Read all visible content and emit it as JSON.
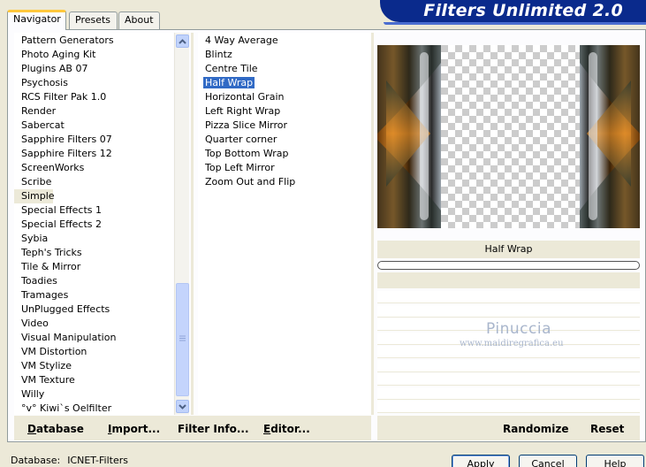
{
  "tabs": [
    "Navigator",
    "Presets",
    "About"
  ],
  "banner": {
    "title": "Filters Unlimited 2.0"
  },
  "categories": [
    "Pattern Generators",
    "Photo Aging Kit",
    "Plugins AB 07",
    "Psychosis",
    "RCS Filter Pak 1.0",
    "Render",
    "Sabercat",
    "Sapphire Filters 07",
    "Sapphire Filters 12",
    "ScreenWorks",
    "Scribe",
    "Simple",
    "Special Effects 1",
    "Special Effects 2",
    "Sybia",
    "Teph's Tricks",
    "Tile & Mirror",
    "Toadies",
    "Tramages",
    "UnPlugged Effects",
    "Video",
    "Visual Manipulation",
    "VM Distortion",
    "VM Stylize",
    "VM Texture",
    "Willy",
    "°v° Kiwi`s Oelfilter"
  ],
  "selected_category": "Simple",
  "filters": [
    "4 Way Average",
    "Blintz",
    "Centre Tile",
    "Half Wrap",
    "Horizontal Grain",
    "Left Right Wrap",
    "Pizza Slice Mirror",
    "Quarter corner",
    "Top Bottom Wrap",
    "Top Left Mirror",
    "Zoom Out and Flip"
  ],
  "selected_filter": "Half Wrap",
  "preview": {
    "filter_name": "Half Wrap"
  },
  "watermark": {
    "title": "Pinuccia",
    "url": "www.maidiregrafica.eu"
  },
  "toolbar": {
    "database": "Database",
    "import": "Import...",
    "filter_info": "Filter Info...",
    "editor": "Editor...",
    "randomize": "Randomize",
    "reset": "Reset"
  },
  "status": {
    "label": "Database:",
    "value": "ICNET-Filters"
  },
  "dialog": {
    "apply": "Apply",
    "cancel": "Cancel",
    "help": "Help"
  },
  "colors": {
    "banner": "#0a2a8c",
    "selection": "#316ac5",
    "face": "#ece9d8"
  },
  "icons": {
    "scroll_up": "chevron-up-icon",
    "scroll_down": "chevron-down-icon"
  }
}
